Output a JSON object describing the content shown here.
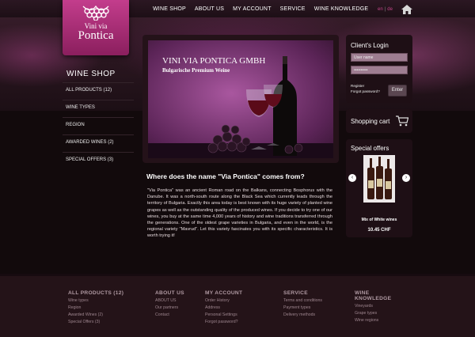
{
  "colors": {
    "accent": "#c33d8c",
    "background": "#120a0c",
    "footer": "#241318"
  },
  "logo": {
    "line1": "Vini via",
    "line2": "Pontica",
    "icon": "grape-cluster-icon"
  },
  "nav": [
    "WINE SHOP",
    "ABOUT US",
    "MY ACCOUNT",
    "SERVICE",
    "WINE KNOWLEDGE"
  ],
  "lang": {
    "en": "en",
    "de": "de"
  },
  "sidebar": {
    "title": "WINE SHOP",
    "items": [
      "ALL PRODUCTS (12)",
      "WINE TYPES",
      "REGION",
      "AWARDED WINES (2)",
      "SPECIAL OFFERS (3)"
    ]
  },
  "hero": {
    "title": "VINI VIA PONTICA GMBH",
    "subtitle": "Bulgarische Premium Weine"
  },
  "login": {
    "title": "Client's Login",
    "username_placeholder": "User name",
    "password_value": "••••••••••",
    "register": "Register",
    "forgot": "Forgot password?",
    "enter": "Enter"
  },
  "cart": {
    "label": "Shopping cart"
  },
  "offers": {
    "title": "Special offers",
    "product_name": "Mix of White wines",
    "price": "10.45 CHF"
  },
  "article": {
    "title": "Where does the name \"Via Pontica\" comes from?",
    "body": "\"Via Pontica\" was an ancient Roman road on the Balkans, connecting Bosphorus with the Danube. It was a north-south route along the Black Sea which currently leads through the territory of Bulgaria. Exactly this area today is best known with its huge variety of planted wine grapes as well as the outstanding quality of the produced wines. If you decide to try one of our wines, you buy at the same time 4,000 years of history and wine traditions transferred through the generations. One of the oldest grape varieties in Bulgaria, and even in the world, is the regional variety \"Mavrud\". Let this variety fascinates you with its specific characteristics. It is worth trying it!"
  },
  "footer": {
    "cols": [
      {
        "title": "ALL PRODUCTS (12)",
        "links": [
          "Wine types",
          "Region",
          "Awarded Wines (2)",
          "Special Offers (3)"
        ]
      },
      {
        "title": "ABOUT US",
        "links": [
          "ABOUT US",
          "Our partners",
          "Contact"
        ]
      },
      {
        "title": "MY ACCOUNT",
        "links": [
          "Order History",
          "Address",
          "Personal Settings",
          "Forgot password?"
        ]
      },
      {
        "title": "SERVICE",
        "links": [
          "Terms and conditions",
          "Payment types",
          "Delivery methods"
        ]
      },
      {
        "title": "WINE KNOWLEDGE",
        "links": [
          "Vineyards",
          "Grape types",
          "Wine regions"
        ]
      }
    ]
  }
}
